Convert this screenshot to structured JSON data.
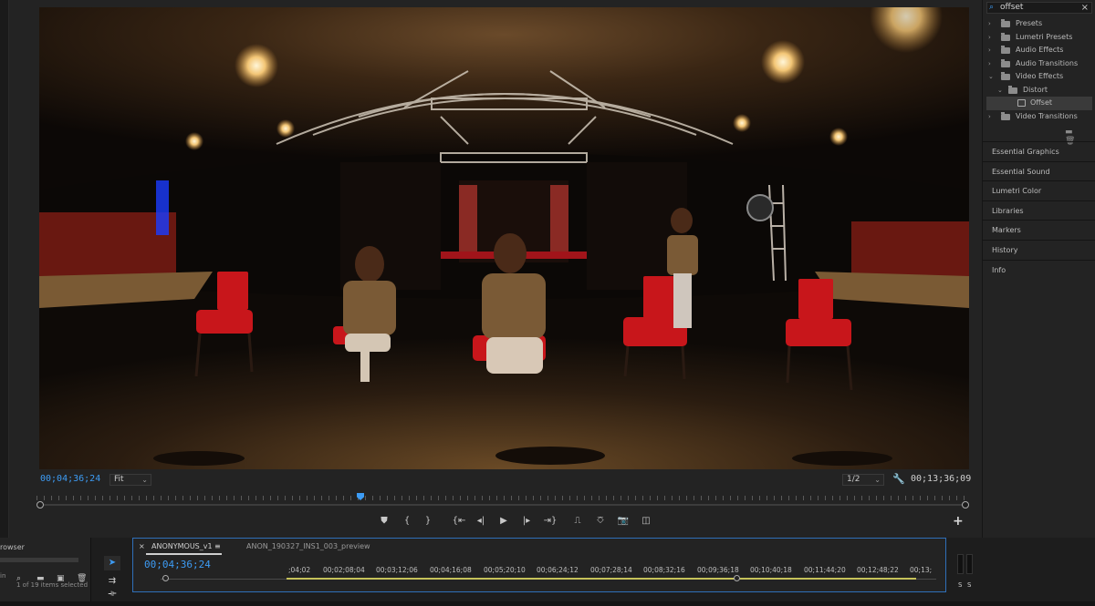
{
  "program_monitor": {
    "current_timecode": "00;04;36;24",
    "zoom_select": "Fit",
    "resolution_select": "1/2",
    "duration_timecode": "00;13;36;09"
  },
  "transport": {
    "marker": "⛊",
    "in": "{",
    "out": "}",
    "go_to_in": "{⇤",
    "step_back": "◂|",
    "play": "▶",
    "step_forward": "|▸",
    "go_to_out": "⇥}",
    "lift": "⎍",
    "extract": "⎏",
    "export_frame": "📷",
    "comparison": "◫",
    "add": "+"
  },
  "effects_panel": {
    "search_value": "offset",
    "tree": [
      {
        "label": "Presets",
        "level": 0,
        "expanded": false
      },
      {
        "label": "Lumetri Presets",
        "level": 0,
        "expanded": false
      },
      {
        "label": "Audio Effects",
        "level": 0,
        "expanded": false
      },
      {
        "label": "Audio Transitions",
        "level": 0,
        "expanded": false
      },
      {
        "label": "Video Effects",
        "level": 0,
        "expanded": true
      },
      {
        "label": "Distort",
        "level": 1,
        "expanded": true
      },
      {
        "label": "Offset",
        "level": 2,
        "selected": true
      },
      {
        "label": "Video Transitions",
        "level": 0,
        "expanded": false
      }
    ]
  },
  "side_panels": [
    "Essential Graphics",
    "Essential Sound",
    "Lumetri Color",
    "Libraries",
    "Markers",
    "History",
    "Info"
  ],
  "project_browser": {
    "title": "rowser",
    "status": "1 of 19 items selected",
    "side_label": "in"
  },
  "timeline": {
    "tabs": [
      "ANONYMOUS_v1",
      "ANON_190327_INS1_003_preview"
    ],
    "active_tab_close": "×",
    "active_tab_menu": "≡",
    "timecode": "00;04;36;24",
    "ruler_labels": [
      ";04;02",
      "00;02;08;04",
      "00;03;12;06",
      "00;04;16;08",
      "00;05;20;10",
      "00;06;24;12",
      "00;07;28;14",
      "00;08;32;16",
      "00;09;36;18",
      "00;10;40;18",
      "00;11;44;20",
      "00;12;48;22",
      "00;13;"
    ]
  },
  "audio_meters": {
    "left": "S",
    "right": "S"
  },
  "colors": {
    "accent_blue": "#3d9cf5",
    "seat_red": "#c8161b",
    "panel_bg": "#232323"
  }
}
